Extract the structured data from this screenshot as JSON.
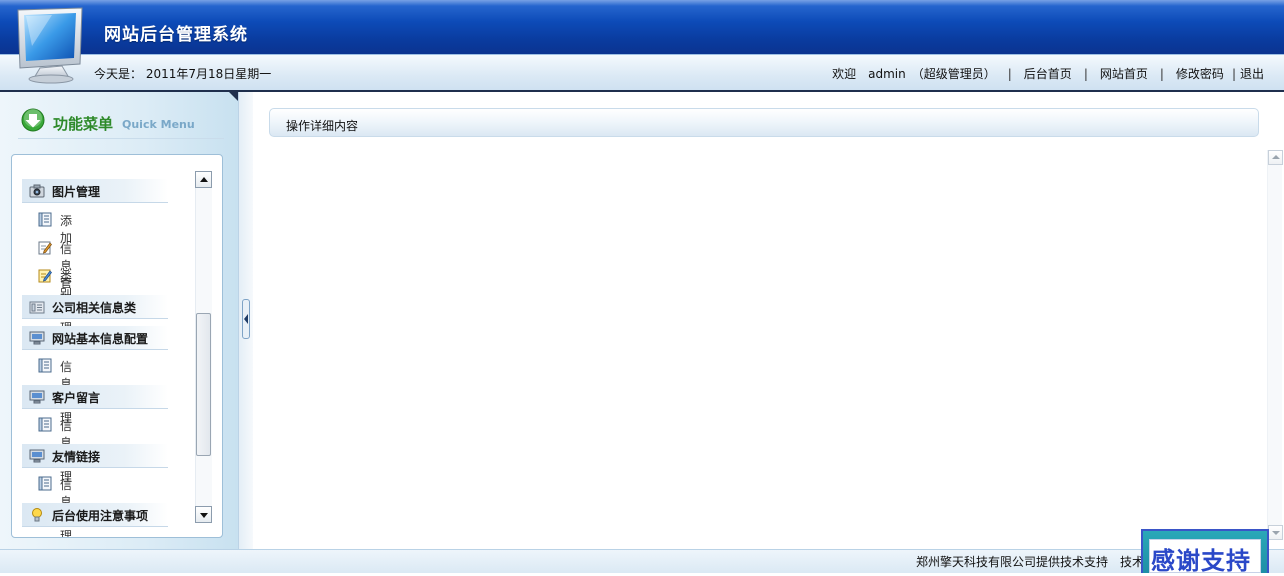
{
  "header": {
    "title": "网站后台管理系统",
    "today": "今天是： 2011年7月18日星期一",
    "welcome": "欢迎　admin　（超级管理员）",
    "links": [
      "后台首页",
      "网站首页",
      "修改密码",
      "退出"
    ]
  },
  "sidebar": {
    "title_cn": "功能菜单",
    "title_en": "Quick Menu",
    "groups": [
      {
        "label": "图片管理",
        "icon": "camera-icon",
        "items": [
          "添加",
          "信息管理",
          "类别管理"
        ]
      },
      {
        "label": "公司相关信息类",
        "icon": "folder-icon",
        "items": []
      },
      {
        "label": "网站基本信息配置",
        "icon": "computer-icon",
        "items": [
          "信息管理"
        ]
      },
      {
        "label": "客户留言",
        "icon": "computer-icon",
        "items": [
          "信息管理"
        ]
      },
      {
        "label": "友情链接",
        "icon": "computer-icon",
        "items": [
          "信息管理"
        ]
      },
      {
        "label": "后台使用注意事项",
        "icon": "lightbulb-icon",
        "items": []
      }
    ]
  },
  "main": {
    "ops_title": "操作详细内容"
  },
  "footer": {
    "text": "郑州擎天科技有限公司提供技术支持　技术支持",
    "thanks": "感谢支持"
  },
  "colors": {
    "header_blue": "#0a3b9e",
    "menu_green": "#2e8a2a",
    "thanks_blue": "#2a48c8"
  }
}
